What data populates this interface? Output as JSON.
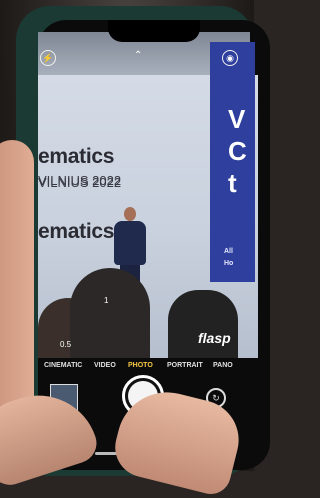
{
  "sign": {
    "title": "ematics",
    "subtitle": "VILNIUS 2022"
  },
  "blue_panel": {
    "letters": [
      "V",
      "C",
      "t"
    ],
    "small_lines": [
      "All",
      "Ho"
    ]
  },
  "camera": {
    "modes": [
      "CINEMATIC",
      "VIDEO",
      "PHOTO",
      "PORTRAIT",
      "PANO"
    ],
    "active_mode": "PHOTO",
    "zoom_marks": [
      "0.5",
      "1"
    ],
    "icons": [
      "flash-icon",
      "chevron-up-icon",
      "live-photo-icon",
      "shutter-icon",
      "flip-camera-icon"
    ]
  },
  "watermark": "flasp"
}
